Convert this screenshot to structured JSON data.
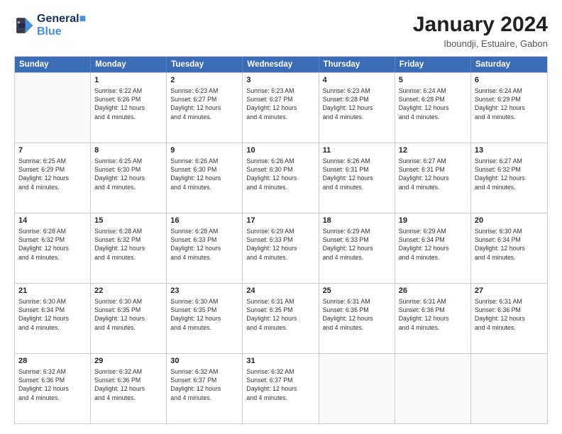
{
  "logo": {
    "line1": "General",
    "line2": "Blue"
  },
  "title": {
    "month_year": "January 2024",
    "location": "Iboundji, Estuaire, Gabon"
  },
  "header_days": [
    "Sunday",
    "Monday",
    "Tuesday",
    "Wednesday",
    "Thursday",
    "Friday",
    "Saturday"
  ],
  "weeks": [
    [
      {
        "day": "",
        "sunrise": "",
        "sunset": "",
        "daylight": ""
      },
      {
        "day": "1",
        "sunrise": "Sunrise: 6:22 AM",
        "sunset": "Sunset: 6:26 PM",
        "daylight": "Daylight: 12 hours and 4 minutes."
      },
      {
        "day": "2",
        "sunrise": "Sunrise: 6:23 AM",
        "sunset": "Sunset: 6:27 PM",
        "daylight": "Daylight: 12 hours and 4 minutes."
      },
      {
        "day": "3",
        "sunrise": "Sunrise: 6:23 AM",
        "sunset": "Sunset: 6:27 PM",
        "daylight": "Daylight: 12 hours and 4 minutes."
      },
      {
        "day": "4",
        "sunrise": "Sunrise: 6:23 AM",
        "sunset": "Sunset: 6:28 PM",
        "daylight": "Daylight: 12 hours and 4 minutes."
      },
      {
        "day": "5",
        "sunrise": "Sunrise: 6:24 AM",
        "sunset": "Sunset: 6:28 PM",
        "daylight": "Daylight: 12 hours and 4 minutes."
      },
      {
        "day": "6",
        "sunrise": "Sunrise: 6:24 AM",
        "sunset": "Sunset: 6:29 PM",
        "daylight": "Daylight: 12 hours and 4 minutes."
      }
    ],
    [
      {
        "day": "7",
        "sunrise": "Sunrise: 6:25 AM",
        "sunset": "Sunset: 6:29 PM",
        "daylight": "Daylight: 12 hours and 4 minutes."
      },
      {
        "day": "8",
        "sunrise": "Sunrise: 6:25 AM",
        "sunset": "Sunset: 6:30 PM",
        "daylight": "Daylight: 12 hours and 4 minutes."
      },
      {
        "day": "9",
        "sunrise": "Sunrise: 6:26 AM",
        "sunset": "Sunset: 6:30 PM",
        "daylight": "Daylight: 12 hours and 4 minutes."
      },
      {
        "day": "10",
        "sunrise": "Sunrise: 6:26 AM",
        "sunset": "Sunset: 6:30 PM",
        "daylight": "Daylight: 12 hours and 4 minutes."
      },
      {
        "day": "11",
        "sunrise": "Sunrise: 6:26 AM",
        "sunset": "Sunset: 6:31 PM",
        "daylight": "Daylight: 12 hours and 4 minutes."
      },
      {
        "day": "12",
        "sunrise": "Sunrise: 6:27 AM",
        "sunset": "Sunset: 6:31 PM",
        "daylight": "Daylight: 12 hours and 4 minutes."
      },
      {
        "day": "13",
        "sunrise": "Sunrise: 6:27 AM",
        "sunset": "Sunset: 6:32 PM",
        "daylight": "Daylight: 12 hours and 4 minutes."
      }
    ],
    [
      {
        "day": "14",
        "sunrise": "Sunrise: 6:28 AM",
        "sunset": "Sunset: 6:32 PM",
        "daylight": "Daylight: 12 hours and 4 minutes."
      },
      {
        "day": "15",
        "sunrise": "Sunrise: 6:28 AM",
        "sunset": "Sunset: 6:32 PM",
        "daylight": "Daylight: 12 hours and 4 minutes."
      },
      {
        "day": "16",
        "sunrise": "Sunrise: 6:28 AM",
        "sunset": "Sunset: 6:33 PM",
        "daylight": "Daylight: 12 hours and 4 minutes."
      },
      {
        "day": "17",
        "sunrise": "Sunrise: 6:29 AM",
        "sunset": "Sunset: 6:33 PM",
        "daylight": "Daylight: 12 hours and 4 minutes."
      },
      {
        "day": "18",
        "sunrise": "Sunrise: 6:29 AM",
        "sunset": "Sunset: 6:33 PM",
        "daylight": "Daylight: 12 hours and 4 minutes."
      },
      {
        "day": "19",
        "sunrise": "Sunrise: 6:29 AM",
        "sunset": "Sunset: 6:34 PM",
        "daylight": "Daylight: 12 hours and 4 minutes."
      },
      {
        "day": "20",
        "sunrise": "Sunrise: 6:30 AM",
        "sunset": "Sunset: 6:34 PM",
        "daylight": "Daylight: 12 hours and 4 minutes."
      }
    ],
    [
      {
        "day": "21",
        "sunrise": "Sunrise: 6:30 AM",
        "sunset": "Sunset: 6:34 PM",
        "daylight": "Daylight: 12 hours and 4 minutes."
      },
      {
        "day": "22",
        "sunrise": "Sunrise: 6:30 AM",
        "sunset": "Sunset: 6:35 PM",
        "daylight": "Daylight: 12 hours and 4 minutes."
      },
      {
        "day": "23",
        "sunrise": "Sunrise: 6:30 AM",
        "sunset": "Sunset: 6:35 PM",
        "daylight": "Daylight: 12 hours and 4 minutes."
      },
      {
        "day": "24",
        "sunrise": "Sunrise: 6:31 AM",
        "sunset": "Sunset: 6:35 PM",
        "daylight": "Daylight: 12 hours and 4 minutes."
      },
      {
        "day": "25",
        "sunrise": "Sunrise: 6:31 AM",
        "sunset": "Sunset: 6:36 PM",
        "daylight": "Daylight: 12 hours and 4 minutes."
      },
      {
        "day": "26",
        "sunrise": "Sunrise: 6:31 AM",
        "sunset": "Sunset: 6:36 PM",
        "daylight": "Daylight: 12 hours and 4 minutes."
      },
      {
        "day": "27",
        "sunrise": "Sunrise: 6:31 AM",
        "sunset": "Sunset: 6:36 PM",
        "daylight": "Daylight: 12 hours and 4 minutes."
      }
    ],
    [
      {
        "day": "28",
        "sunrise": "Sunrise: 6:32 AM",
        "sunset": "Sunset: 6:36 PM",
        "daylight": "Daylight: 12 hours and 4 minutes."
      },
      {
        "day": "29",
        "sunrise": "Sunrise: 6:32 AM",
        "sunset": "Sunset: 6:36 PM",
        "daylight": "Daylight: 12 hours and 4 minutes."
      },
      {
        "day": "30",
        "sunrise": "Sunrise: 6:32 AM",
        "sunset": "Sunset: 6:37 PM",
        "daylight": "Daylight: 12 hours and 4 minutes."
      },
      {
        "day": "31",
        "sunrise": "Sunrise: 6:32 AM",
        "sunset": "Sunset: 6:37 PM",
        "daylight": "Daylight: 12 hours and 4 minutes."
      },
      {
        "day": "",
        "sunrise": "",
        "sunset": "",
        "daylight": ""
      },
      {
        "day": "",
        "sunrise": "",
        "sunset": "",
        "daylight": ""
      },
      {
        "day": "",
        "sunrise": "",
        "sunset": "",
        "daylight": ""
      }
    ]
  ]
}
